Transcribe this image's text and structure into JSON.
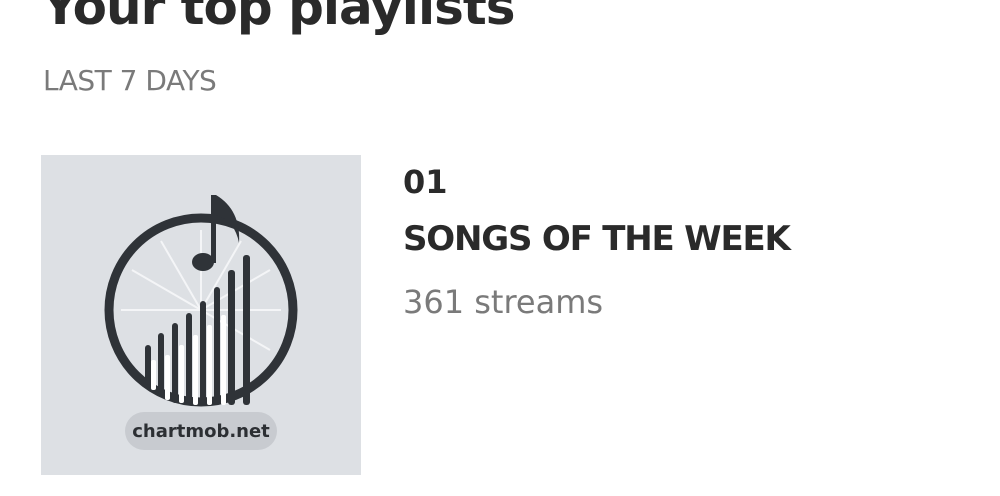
{
  "header": {
    "title": "Your top playlists",
    "period": "LAST 7 DAYS"
  },
  "playlists": [
    {
      "rank": "01",
      "name": "SONGS OF THE WEEK",
      "streams": "361 streams",
      "cover": {
        "site_text": "chartmob.net",
        "icon": "music-note-equalizer-logo"
      }
    }
  ]
}
